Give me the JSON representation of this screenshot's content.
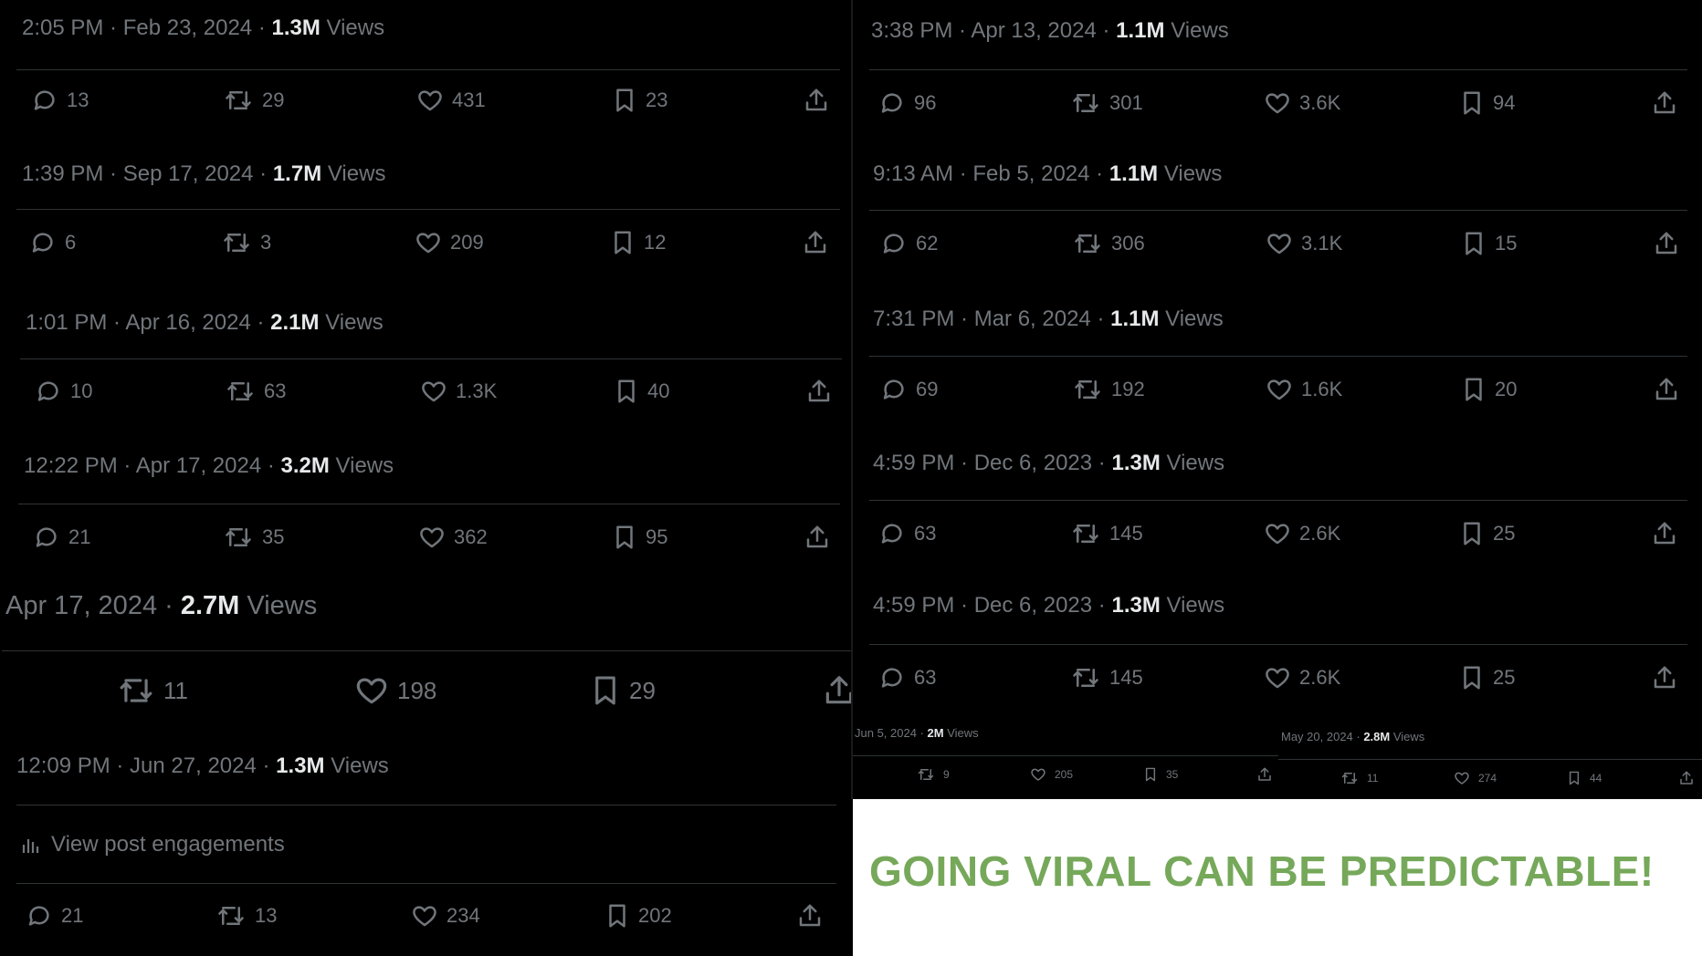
{
  "headline": "GOING VIRAL CAN BE PREDICTABLE!",
  "views_word": "Views",
  "engagements_label": "View post engagements",
  "posts": [
    {
      "time": "2:05 PM · Feb 23, 2024 · ",
      "views": "1.3M",
      "replies": "13",
      "reposts": "29",
      "likes": "431",
      "bookmarks": "23"
    },
    {
      "time": "1:39 PM · Sep 17, 2024 · ",
      "views": "1.7M",
      "replies": "6",
      "reposts": "3",
      "likes": "209",
      "bookmarks": "12"
    },
    {
      "time": "1:01 PM · Apr 16, 2024 · ",
      "views": "2.1M",
      "replies": "10",
      "reposts": "63",
      "likes": "1.3K",
      "bookmarks": "40"
    },
    {
      "time": "12:22 PM · Apr 17, 2024 · ",
      "views": "3.2M",
      "replies": "21",
      "reposts": "35",
      "likes": "362",
      "bookmarks": "95"
    },
    {
      "time": "Apr 17, 2024 · ",
      "views": "2.7M",
      "reposts": "11",
      "likes": "198",
      "bookmarks": "29"
    },
    {
      "time": "12:09 PM · Jun 27, 2024 · ",
      "views": "1.3M",
      "replies": "21",
      "reposts": "13",
      "likes": "234",
      "bookmarks": "202"
    },
    {
      "time": "3:38 PM · Apr 13, 2024 · ",
      "views": "1.1M",
      "replies": "96",
      "reposts": "301",
      "likes": "3.6K",
      "bookmarks": "94"
    },
    {
      "time": "9:13 AM · Feb 5, 2024 · ",
      "views": "1.1M",
      "replies": "62",
      "reposts": "306",
      "likes": "3.1K",
      "bookmarks": "15"
    },
    {
      "time": "7:31 PM · Mar 6, 2024 · ",
      "views": "1.1M",
      "replies": "69",
      "reposts": "192",
      "likes": "1.6K",
      "bookmarks": "20"
    },
    {
      "time": "4:59 PM · Dec 6, 2023 · ",
      "views": "1.3M",
      "replies": "63",
      "reposts": "145",
      "likes": "2.6K",
      "bookmarks": "25"
    },
    {
      "time": "4:59 PM · Dec 6, 2023 · ",
      "views": "1.3M",
      "replies": "63",
      "reposts": "145",
      "likes": "2.6K",
      "bookmarks": "25"
    },
    {
      "time": "Jun 5, 2024 · ",
      "views": "2M",
      "reposts": "9",
      "likes": "205",
      "bookmarks": "35"
    },
    {
      "time": "May 20, 2024 · ",
      "views": "2.8M",
      "reposts": "11",
      "likes": "274",
      "bookmarks": "44"
    }
  ]
}
